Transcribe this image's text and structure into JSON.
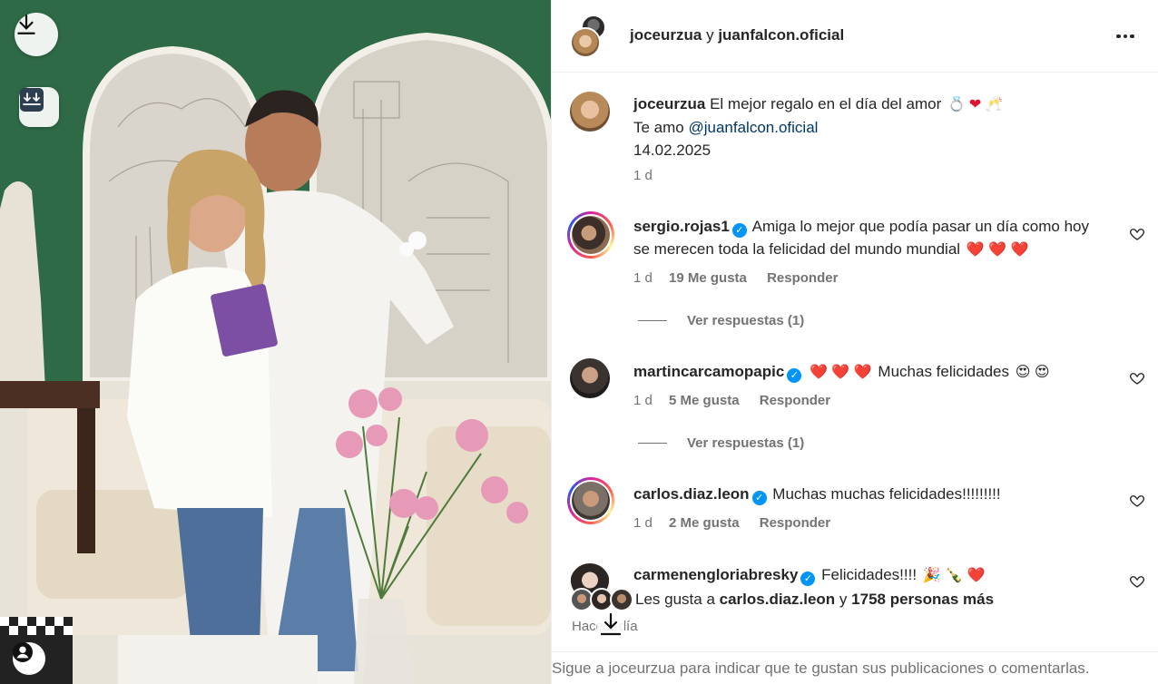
{
  "post": {
    "header": {
      "user1": "joceurzua",
      "connector": "y",
      "user2": "juanfalcon.oficial",
      "more_icon": "ellipsis-icon"
    },
    "caption": {
      "username": "joceurzua",
      "text": "El mejor regalo en el día del amor",
      "emojis": [
        "ring",
        "heart",
        "clinking-glasses"
      ],
      "line2_prefix": "Te amo",
      "mention": "@juanfalcon.oficial",
      "date_line": "14.02.2025",
      "time": "1 d"
    },
    "comments": [
      {
        "username": "sergio.rojas1",
        "verified": true,
        "text": "Amiga lo mejor que podía pasar un día como hoy se merecen toda la felicidad del mundo mundial",
        "trailing": "❤️ ❤️ ❤️",
        "time": "1 d",
        "likes": "19 Me gusta",
        "reply": "Responder",
        "view_replies": "Ver respuestas (1)"
      },
      {
        "username": "martincarcamopapic",
        "verified": true,
        "leading": "❤️ ❤️ ❤️",
        "text": "Muchas felicidades",
        "trailing": "😍 😍",
        "time": "1 d",
        "likes": "5 Me gusta",
        "reply": "Responder",
        "view_replies": "Ver respuestas (1)"
      },
      {
        "username": "carlos.diaz.leon",
        "verified": true,
        "text": "Muchas muchas felicidades!!!!!!!!!",
        "time": "1 d",
        "likes": "2 Me gusta",
        "reply": "Responder"
      },
      {
        "username": "carmenengloriabresky",
        "verified": true,
        "text": "Felicidades!!!!",
        "trailing": "🎉 🍾 ❤️"
      }
    ],
    "likes": {
      "prefix": "Les gusta a",
      "user": "carlos.diaz.leon",
      "middle": "y",
      "count": "1758 personas más"
    },
    "time_ago": "Hace 1 día",
    "footer": "Sigue a joceurzua para indicar que te gustan sus publicaciones o comentarlas."
  },
  "colors": {
    "link": "#00376b",
    "verified": "#0095f6",
    "muted": "#737373",
    "heart": "#e0142c"
  }
}
